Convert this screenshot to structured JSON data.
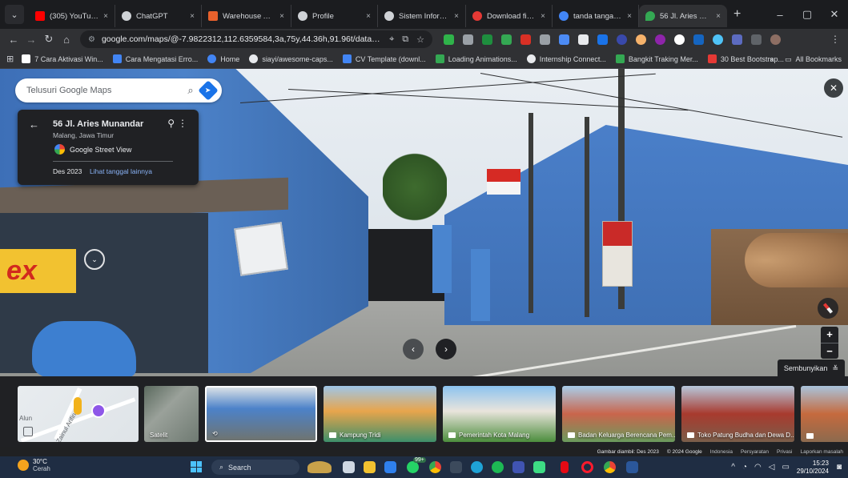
{
  "browser": {
    "menu_icon": "chevron-down-icon",
    "tabs": [
      {
        "title": "(305) YouTube",
        "color": "#ff0000"
      },
      {
        "title": "ChatGPT",
        "color": "#cfd2d6"
      },
      {
        "title": "Warehouse Adm",
        "color": "#e8612c"
      },
      {
        "title": "Profile",
        "color": "#cfd2d6"
      },
      {
        "title": "Sistem Informasi",
        "color": "#cfd2d6"
      },
      {
        "title": "Download file |",
        "color": "#e53935"
      },
      {
        "title": "tanda tangan lu",
        "color": "#4285f4"
      },
      {
        "title": "56 Jl. Aries Muna",
        "color": "#34a853"
      }
    ],
    "tab_close": "×",
    "new_tab": "+",
    "window_controls": {
      "minimize": "–",
      "maximize": "▢",
      "close": "✕"
    },
    "url": "google.com/maps/@-7.9822312,112.6359584,3a,75y,44.36h,91.96t/data=!3m7!1e1...",
    "bookmarks": [
      {
        "label": "7 Cara Aktivasi Win...",
        "color": "#ffffff"
      },
      {
        "label": "Cara Mengatasi Erro...",
        "color": "#4285f4"
      },
      {
        "label": "Home",
        "color": "#4285f4"
      },
      {
        "label": "siayi/awesome-caps...",
        "color": "#e8eaed"
      },
      {
        "label": "CV Template (downl...",
        "color": "#4285f4"
      },
      {
        "label": "Loading Animations...",
        "color": "#34a853"
      },
      {
        "label": "Internship Connect...",
        "color": "#e8eaed"
      },
      {
        "label": "Bangkit Traking Mer...",
        "color": "#34a853"
      },
      {
        "label": "30 Best Bootstrap...",
        "color": "#e53935"
      }
    ],
    "bookmarks_overflow": "»",
    "all_bookmarks": "All Bookmarks"
  },
  "maps": {
    "search_placeholder": "Telusuri Google Maps",
    "place": {
      "title": "56 Jl. Aries Munandar",
      "subtitle": "Malang, Jawa Timur",
      "source": "Google Street View",
      "date": "Des 2023",
      "other_dates_link": "Lihat tanggal lainnya"
    },
    "signage": {
      "ex": "ex"
    },
    "hide_button": "Sembunyikan",
    "thumbnails": [
      {
        "label": "",
        "type": "map"
      },
      {
        "label": "Satelit",
        "type": "satellite"
      },
      {
        "label": "",
        "type": "street"
      },
      {
        "label": "Kampung Tridi",
        "type": "photo"
      },
      {
        "label": "Pemerintah Kota Malang",
        "type": "photo"
      },
      {
        "label": "Badan Keluarga Berencana Pem...",
        "type": "photo"
      },
      {
        "label": "Toko Patung Budha dan Dewa D...",
        "type": "photo"
      },
      {
        "label": "",
        "type": "photo"
      }
    ],
    "map_labels": {
      "street": "Zainul Arifin",
      "area": "Alun"
    },
    "attribution": {
      "capture": "Gambar diambil: Des 2023",
      "copyright": "© 2024 Google",
      "country": "Indonesia",
      "terms": "Persyaratan",
      "privacy": "Privasi",
      "report": "Laporkan masalah"
    }
  },
  "taskbar": {
    "weather_temp": "30°C",
    "weather_condition": "Cerah",
    "search_label": "Search",
    "time": "15:23",
    "date": "29/10/2024",
    "chat_badge": "99+"
  }
}
